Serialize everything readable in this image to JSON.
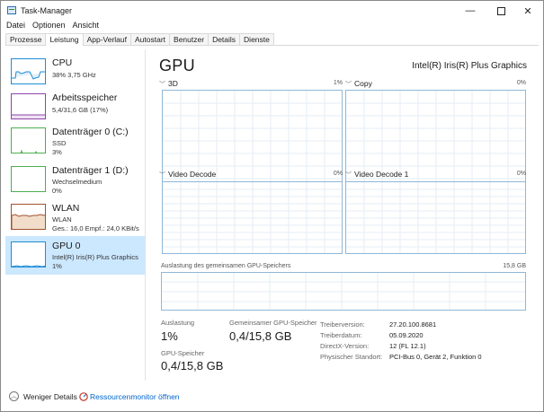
{
  "window": {
    "title": "Task-Manager",
    "controls": {
      "minimize": "—",
      "close": "✕"
    }
  },
  "menu": [
    "Datei",
    "Optionen",
    "Ansicht"
  ],
  "tabs": [
    "Prozesse",
    "Leistung",
    "App-Verlauf",
    "Autostart",
    "Benutzer",
    "Details",
    "Dienste"
  ],
  "active_tab": "Leistung",
  "sidebar": {
    "items": [
      {
        "title": "CPU",
        "sub1": "38% 3,75 GHz",
        "sub2": "",
        "color": "#1f8dd6",
        "fill": 0.38
      },
      {
        "title": "Arbeitsspeicher",
        "sub1": "5,4/31,6 GB (17%)",
        "sub2": "",
        "color": "#8e44ad",
        "fill": 0.17
      },
      {
        "title": "Datenträger 0 (C:)",
        "sub1": "SSD",
        "sub2": "3%",
        "color": "#4caf50",
        "fill": 0.03
      },
      {
        "title": "Datenträger 1 (D:)",
        "sub1": "Wechselmedium",
        "sub2": "0%",
        "color": "#4caf50",
        "fill": 0.0
      },
      {
        "title": "WLAN",
        "sub1": "WLAN",
        "sub2": "Ges.: 16,0  Empf.: 24,0 KBit/s",
        "color": "#a0522d",
        "fill": 0.6
      },
      {
        "title": "GPU 0",
        "sub1": "Intel(R) Iris(R) Plus Graphics",
        "sub2": "1%",
        "color": "#1f8dd6",
        "fill": 0.01,
        "selected": true
      }
    ]
  },
  "main": {
    "title": "GPU",
    "gpu_name": "Intel(R) Iris(R) Plus Graphics",
    "graphs": [
      {
        "label": "3D",
        "pct": "1%"
      },
      {
        "label": "Copy",
        "pct": "0%"
      },
      {
        "label": "Video Decode",
        "pct": "0%"
      },
      {
        "label": "Video Decode 1",
        "pct": "0%"
      }
    ],
    "shared_memory_label": "Auslastung des gemeinsamen GPU-Speichers",
    "shared_memory_max": "15,8 GB",
    "stats": {
      "utilization_label": "Auslastung",
      "utilization_value": "1%",
      "shared_label": "Gemeinsamer GPU-Speicher",
      "shared_value": "0,4/15,8 GB",
      "gpu_mem_label": "GPU-Speicher",
      "gpu_mem_value": "0,4/15,8 GB"
    },
    "info": [
      {
        "key": "Treiberversion:",
        "value": "27.20.100.8681"
      },
      {
        "key": "Treiberdatum:",
        "value": "05.09.2020"
      },
      {
        "key": "DirectX-Version:",
        "value": "12 (FL 12.1)"
      },
      {
        "key": "Physischer Standort:",
        "value": "PCI-Bus 0, Gerät 2, Funktion 0"
      }
    ]
  },
  "footer": {
    "less_details": "Weniger Details",
    "resource_monitor": "Ressourcenmonitor öffnen"
  },
  "colors": {
    "accent": "#1f8dd6",
    "selection": "#cce8ff",
    "graph_border": "#8fb7d8",
    "grid": "#e6eef5"
  }
}
